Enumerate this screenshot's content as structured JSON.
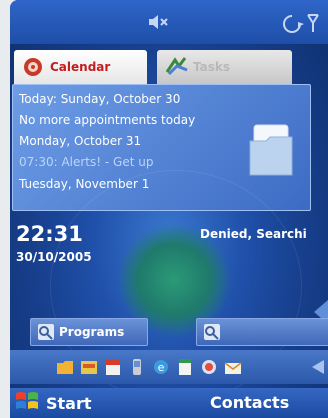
{
  "tabs": [
    {
      "label": "Calendar"
    },
    {
      "label": "Tasks"
    }
  ],
  "agenda": {
    "lines": [
      "Today: Sunday, October 30",
      "No more appointments today",
      "Monday, October 31",
      "07:30: Alerts! - Get up",
      "Tuesday, November 1"
    ]
  },
  "clock": {
    "time": "22:31",
    "date": "30/10/2005"
  },
  "status": {
    "text": "Denied, Searchi"
  },
  "launchers": {
    "programs_label": "Programs"
  },
  "softkeys": {
    "left": "Start",
    "right": "Contacts"
  },
  "icons": {
    "status": [
      "speaker-muted-icon",
      "signal-icon"
    ],
    "strip": [
      "folder-icon",
      "inbox-icon",
      "calendar-icon",
      "phone-icon",
      "internet-explorer-icon",
      "notes-icon",
      "media-icon",
      "mail-icon"
    ]
  },
  "colors": {
    "accent_red": "#c41d1d",
    "background_blue": "#1f4fa8"
  }
}
